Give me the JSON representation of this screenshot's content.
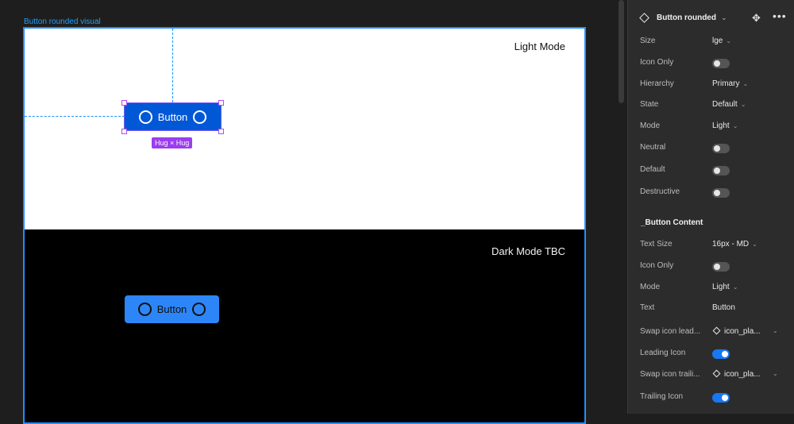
{
  "canvas": {
    "frame_label": "Button rounded visual",
    "light": {
      "title": "Light Mode",
      "button_label": "Button",
      "hug_badge": "Hug × Hug"
    },
    "dark": {
      "title": "Dark  Mode TBC",
      "button_label": "Button"
    }
  },
  "panel": {
    "component_name": "Button rounded",
    "properties": [
      {
        "label": "Size",
        "value": "lge"
      },
      {
        "label": "Icon Only",
        "toggle": false
      },
      {
        "label": "Hierarchy",
        "value": "Primary"
      },
      {
        "label": "State",
        "value": "Default"
      },
      {
        "label": "Mode",
        "value": "Light"
      },
      {
        "label": "Neutral",
        "toggle": false
      },
      {
        "label": "Default",
        "toggle": false
      },
      {
        "label": "Destructive",
        "toggle": false
      }
    ],
    "section_title": "_Button Content",
    "content_properties": [
      {
        "label": "Text Size",
        "value": "16px - MD"
      },
      {
        "label": "Icon Only",
        "toggle": false
      },
      {
        "label": "Mode",
        "value": "Light"
      },
      {
        "label": "Text",
        "value": "Button"
      },
      {
        "label": "Swap icon lead...",
        "instance": "icon_pla..."
      },
      {
        "label": "Leading Icon",
        "toggle": true
      },
      {
        "label": "Swap icon traili...",
        "instance": "icon_pla..."
      },
      {
        "label": "Trailing Icon",
        "toggle": true
      }
    ]
  },
  "colors": {
    "accent": "#1e90ff",
    "light_button": "#0058d6",
    "dark_button": "#2d86f7",
    "badge": "#9b3df0",
    "toggle_on": "#1778f2"
  }
}
